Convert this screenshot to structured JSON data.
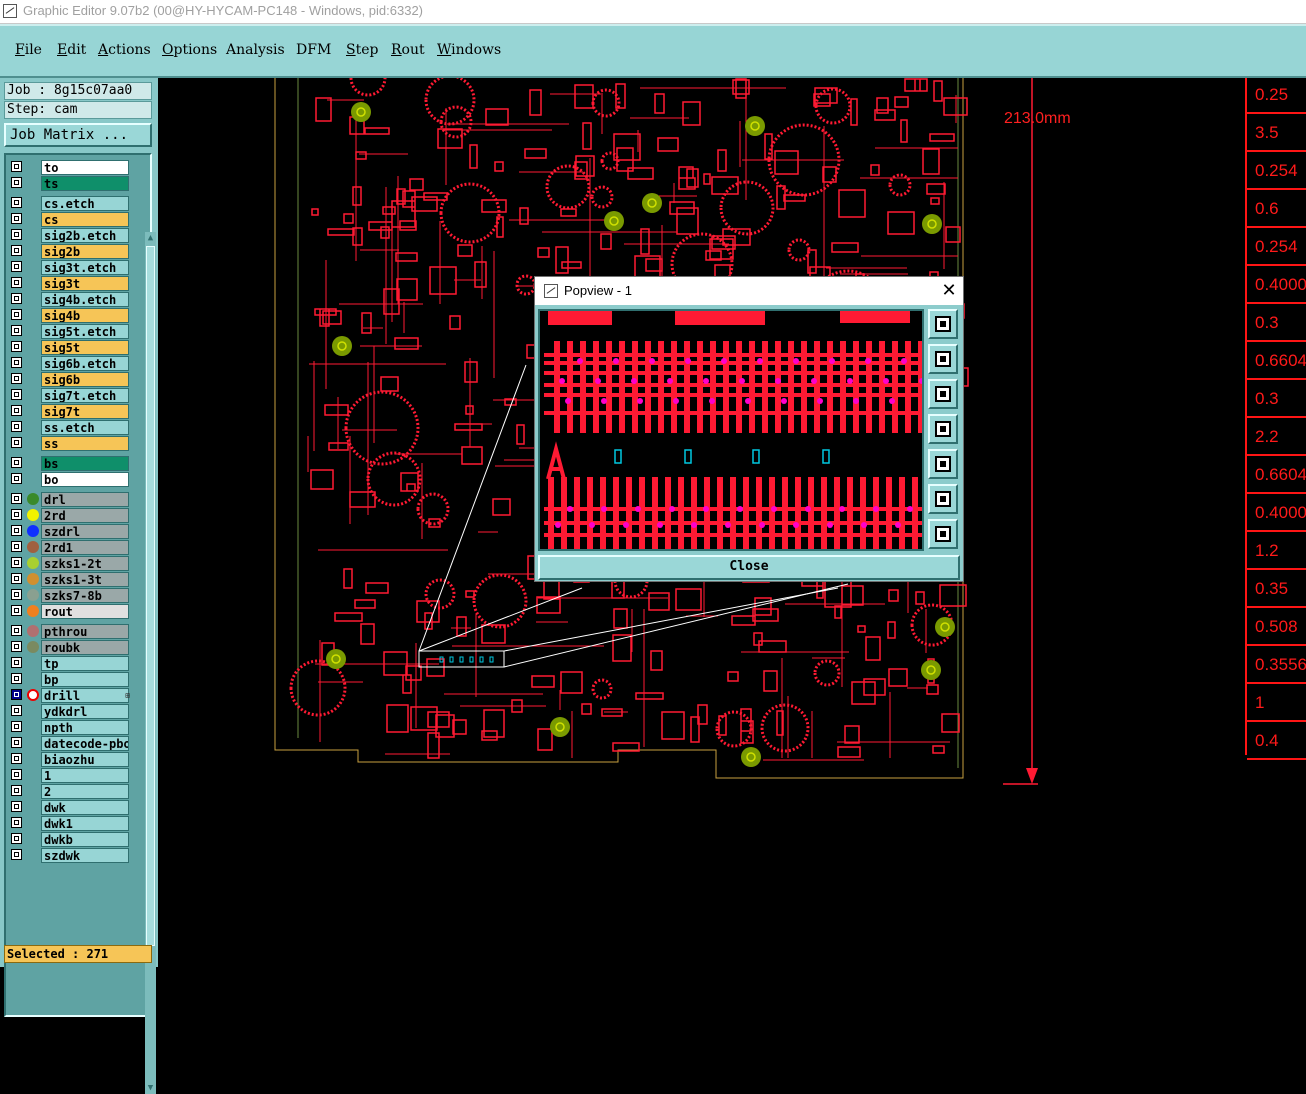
{
  "window": {
    "title": "Graphic Editor 9.07b2 (00@HY-HYCAM-PC148 - Windows, pid:6332)"
  },
  "menu": [
    {
      "label": "File",
      "u": "F",
      "rest": "ile"
    },
    {
      "label": "Edit",
      "u": "E",
      "rest": "dit"
    },
    {
      "label": "Actions",
      "u": "A",
      "rest": "ctions"
    },
    {
      "label": "Options",
      "u": "O",
      "rest": "ptions"
    },
    {
      "label": "Analysis",
      "u": "",
      "rest": "Analysis"
    },
    {
      "label": "DFM",
      "u": "",
      "rest": "DFM"
    },
    {
      "label": "Step",
      "u": "S",
      "rest": "tep"
    },
    {
      "label": "Rout",
      "u": "R",
      "rest": "out"
    },
    {
      "label": "Windows",
      "u": "W",
      "rest": "indows"
    }
  ],
  "job": {
    "label": "Job : 8g15c07aa0",
    "step": "Step: cam"
  },
  "job_matrix_label": "Job Matrix ...",
  "layers": [
    {
      "name": "to",
      "bg": "#ffffff"
    },
    {
      "name": "ts",
      "bg": "#0f8f6a"
    },
    {
      "name": "cs.etch",
      "bg": "#97d5d5"
    },
    {
      "name": "cs",
      "bg": "#f6c557"
    },
    {
      "name": "sig2b.etch",
      "bg": "#97d5d5"
    },
    {
      "name": "sig2b",
      "bg": "#f6c557"
    },
    {
      "name": "sig3t.etch",
      "bg": "#97d5d5"
    },
    {
      "name": "sig3t",
      "bg": "#f6c557"
    },
    {
      "name": "sig4b.etch",
      "bg": "#97d5d5"
    },
    {
      "name": "sig4b",
      "bg": "#f6c557"
    },
    {
      "name": "sig5t.etch",
      "bg": "#97d5d5"
    },
    {
      "name": "sig5t",
      "bg": "#f6c557"
    },
    {
      "name": "sig6b.etch",
      "bg": "#97d5d5"
    },
    {
      "name": "sig6b",
      "bg": "#f6c557"
    },
    {
      "name": "sig7t.etch",
      "bg": "#97d5d5"
    },
    {
      "name": "sig7t",
      "bg": "#f6c557"
    },
    {
      "name": "ss.etch",
      "bg": "#97d5d5"
    },
    {
      "name": "ss",
      "bg": "#f6c557"
    },
    {
      "name": "bs",
      "bg": "#0f8f6a"
    },
    {
      "name": "bo",
      "bg": "#ffffff"
    },
    {
      "name": "drl",
      "bg": "#9aa8a8",
      "dot": "#3a8a2a"
    },
    {
      "name": "2rd",
      "bg": "#9aa8a8",
      "dot": "#f2f200"
    },
    {
      "name": "szdrl",
      "bg": "#9aa8a8",
      "dot": "#1030ff"
    },
    {
      "name": "2rd1",
      "bg": "#9aa8a8",
      "dot": "#a06040"
    },
    {
      "name": "szks1-2t",
      "bg": "#9aa8a8",
      "dot": "#a8d030"
    },
    {
      "name": "szks1-3t",
      "bg": "#9aa8a8",
      "dot": "#d09030"
    },
    {
      "name": "szks7-8b",
      "bg": "#9aa8a8",
      "dot": "#8aa090"
    },
    {
      "name": "rout",
      "bg": "#e0e0e0",
      "dot": "#f08020"
    },
    {
      "name": "pthrou",
      "bg": "#9aa8a8",
      "dot": "#b07070"
    },
    {
      "name": "roubk",
      "bg": "#9aa8a8",
      "dot": "#7a8a60"
    },
    {
      "name": "tp",
      "bg": "#97d5d5"
    },
    {
      "name": "bp",
      "bg": "#97d5d5"
    },
    {
      "name": "drill",
      "bg": "#97d5d5",
      "selected": true,
      "extra": "⊞"
    },
    {
      "name": "ydkdrl",
      "bg": "#97d5d5"
    },
    {
      "name": "npth",
      "bg": "#97d5d5"
    },
    {
      "name": "datecode-pbo",
      "bg": "#97d5d5"
    },
    {
      "name": "biaozhu",
      "bg": "#97d5d5"
    },
    {
      "name": "1",
      "bg": "#97d5d5"
    },
    {
      "name": "2",
      "bg": "#97d5d5"
    },
    {
      "name": "dwk",
      "bg": "#97d5d5"
    },
    {
      "name": "dwk1",
      "bg": "#97d5d5"
    },
    {
      "name": "dwkb",
      "bg": "#97d5d5"
    },
    {
      "name": "szdwk",
      "bg": "#97d5d5"
    }
  ],
  "selected_label": "Selected : 271",
  "dimension_label": "213.0mm",
  "dimensions": [
    "0.25",
    "3.5",
    "0.254",
    "0.6",
    "0.254",
    "0.4000",
    "0.3",
    "0.6604",
    "0.3",
    "2.2",
    "0.6604",
    "0.4000",
    "1.2",
    "0.35",
    "0.508",
    "0.3556",
    "1",
    "0.4"
  ],
  "popview": {
    "title": "Popview - 1",
    "close_x": "✕",
    "close_label": "Close",
    "tools": [
      "zoom-fit-icon",
      "page-up-icon",
      "page-down-icon",
      "page-left-icon",
      "page-right-icon",
      "zoom-in-icon",
      "zoom-out-icon"
    ]
  },
  "colors": {
    "trace": "#ff1a33",
    "pad": "#ff00cc",
    "accent": "#97d5d5",
    "via": "#c8d400"
  }
}
